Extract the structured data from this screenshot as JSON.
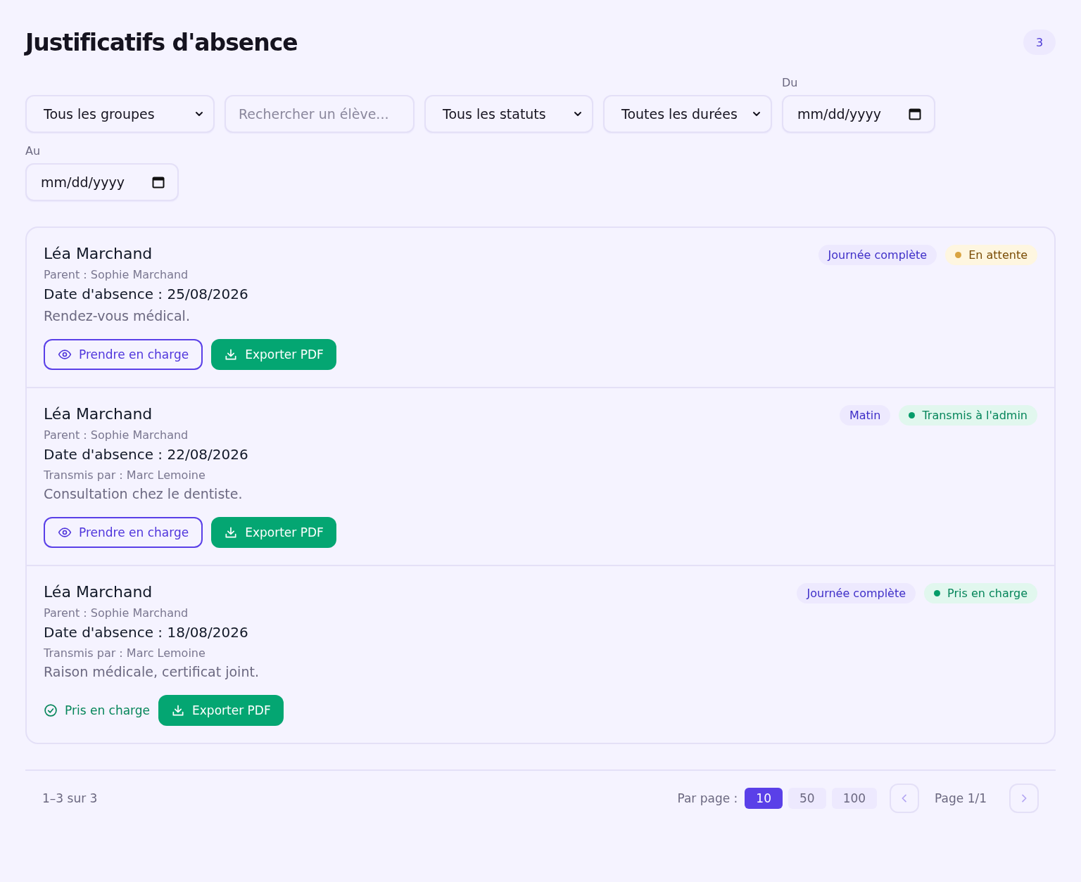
{
  "header": {
    "title": "Justificatifs d'absence",
    "count": "3"
  },
  "filters": [
    {
      "kind": "select",
      "value": "Tous les groupes"
    },
    {
      "kind": "search",
      "placeholder": "Rechercher un élève..."
    },
    {
      "kind": "select",
      "value": "Tous les statuts"
    },
    {
      "kind": "select",
      "value": "Toutes les durées"
    },
    {
      "kind": "date",
      "label": "Du",
      "value": "mm/dd/yyyy"
    },
    {
      "kind": "date",
      "label": "Au",
      "value": "mm/dd/yyyy"
    }
  ],
  "absences": [
    {
      "student": "Léa Marchand",
      "parent": "Parent : Sophie Marchand",
      "date": "Date d'absence : 25/08/2026",
      "reason": "Rendez-vous médical.",
      "duration": "Journée complète",
      "status": {
        "label": "En attente",
        "kind": "pending"
      },
      "actions": [
        {
          "kind": "take",
          "label": "Prendre en charge"
        },
        {
          "kind": "export",
          "label": "Exporter PDF"
        }
      ]
    },
    {
      "student": "Léa Marchand",
      "parent": "Parent : Sophie Marchand",
      "date": "Date d'absence : 22/08/2026",
      "transmitted_by": "Transmis par : Marc Lemoine",
      "reason": "Consultation chez le dentiste.",
      "duration": "Matin",
      "status": {
        "label": "Transmis à l'admin",
        "kind": "sent"
      },
      "actions": [
        {
          "kind": "take",
          "label": "Prendre en charge"
        },
        {
          "kind": "export",
          "label": "Exporter PDF"
        }
      ]
    },
    {
      "student": "Léa Marchand",
      "parent": "Parent : Sophie Marchand",
      "date": "Date d'absence : 18/08/2026",
      "transmitted_by": "Transmis par : Marc Lemoine",
      "reason": "Raison médicale, certificat joint.",
      "duration": "Journée complète",
      "status": {
        "label": "Pris en charge",
        "kind": "taken"
      },
      "actions": [
        {
          "kind": "taken",
          "label": "Pris en charge"
        },
        {
          "kind": "export",
          "label": "Exporter PDF"
        }
      ]
    }
  ],
  "footer": {
    "range": "1–3 sur 3",
    "per_page_label": "Par page :",
    "per_page": [
      {
        "label": "10",
        "selected": true
      },
      {
        "label": "50",
        "selected": false
      },
      {
        "label": "100",
        "selected": false
      }
    ],
    "prev": {
      "disabled": true
    },
    "page": "Page 1/1",
    "next": {
      "disabled": true
    }
  }
}
